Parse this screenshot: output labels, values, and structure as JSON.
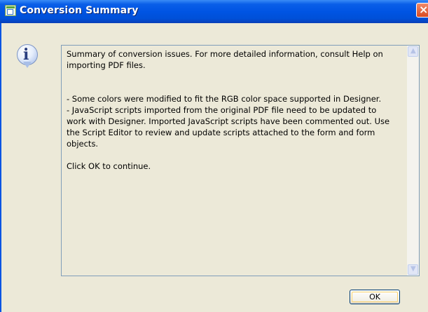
{
  "window": {
    "title": "Conversion Summary",
    "close_glyph": "×"
  },
  "icons": {
    "app": "app-icon",
    "info": "info-icon",
    "info_glyph": "i",
    "scroll_up": "▲",
    "scroll_down": "▼"
  },
  "message": {
    "text": "Summary of conversion issues. For more detailed information, consult Help on\nimporting PDF files.\n\n\n- Some colors were modified to fit the RGB color space supported in Designer.\n- JavaScript scripts imported from the original PDF file need to be updated to\nwork with Designer. Imported JavaScript scripts have been commented out. Use\nthe Script Editor to review and update scripts attached to the form and form\nobjects.\n\nClick OK to continue."
  },
  "buttons": {
    "ok_label": "OK"
  },
  "colors": {
    "titlebar": "#0054e3",
    "window_bg": "#ece9d8",
    "close": "#d94a22"
  }
}
